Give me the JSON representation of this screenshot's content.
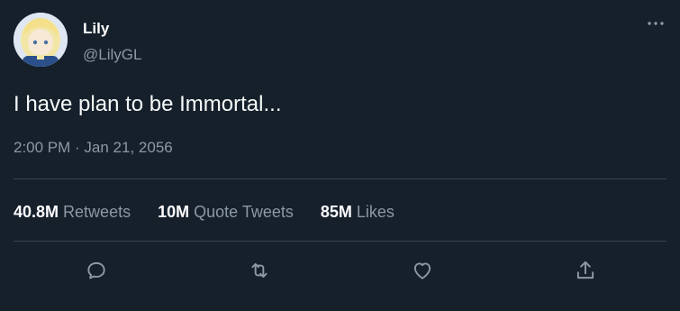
{
  "author": {
    "display_name": "Lily",
    "handle": "@LilyGL",
    "avatar_icon": "avatar-icon"
  },
  "tweet": {
    "text": "I have plan to be Immortal...",
    "timestamp": "2:00 PM · Jan 21, 2056"
  },
  "stats": {
    "retweets": {
      "count": "40.8M",
      "label": "Retweets"
    },
    "quote_tweets": {
      "count": "10M",
      "label": "Quote Tweets"
    },
    "likes": {
      "count": "85M",
      "label": "Likes"
    }
  },
  "actions": [
    {
      "icon": "reply-icon"
    },
    {
      "icon": "retweet-icon"
    },
    {
      "icon": "like-icon"
    },
    {
      "icon": "share-icon"
    }
  ],
  "colors": {
    "background": "#15202b",
    "primary_text": "#ffffff",
    "secondary_text": "#8b98a5",
    "divider": "#38444d"
  }
}
